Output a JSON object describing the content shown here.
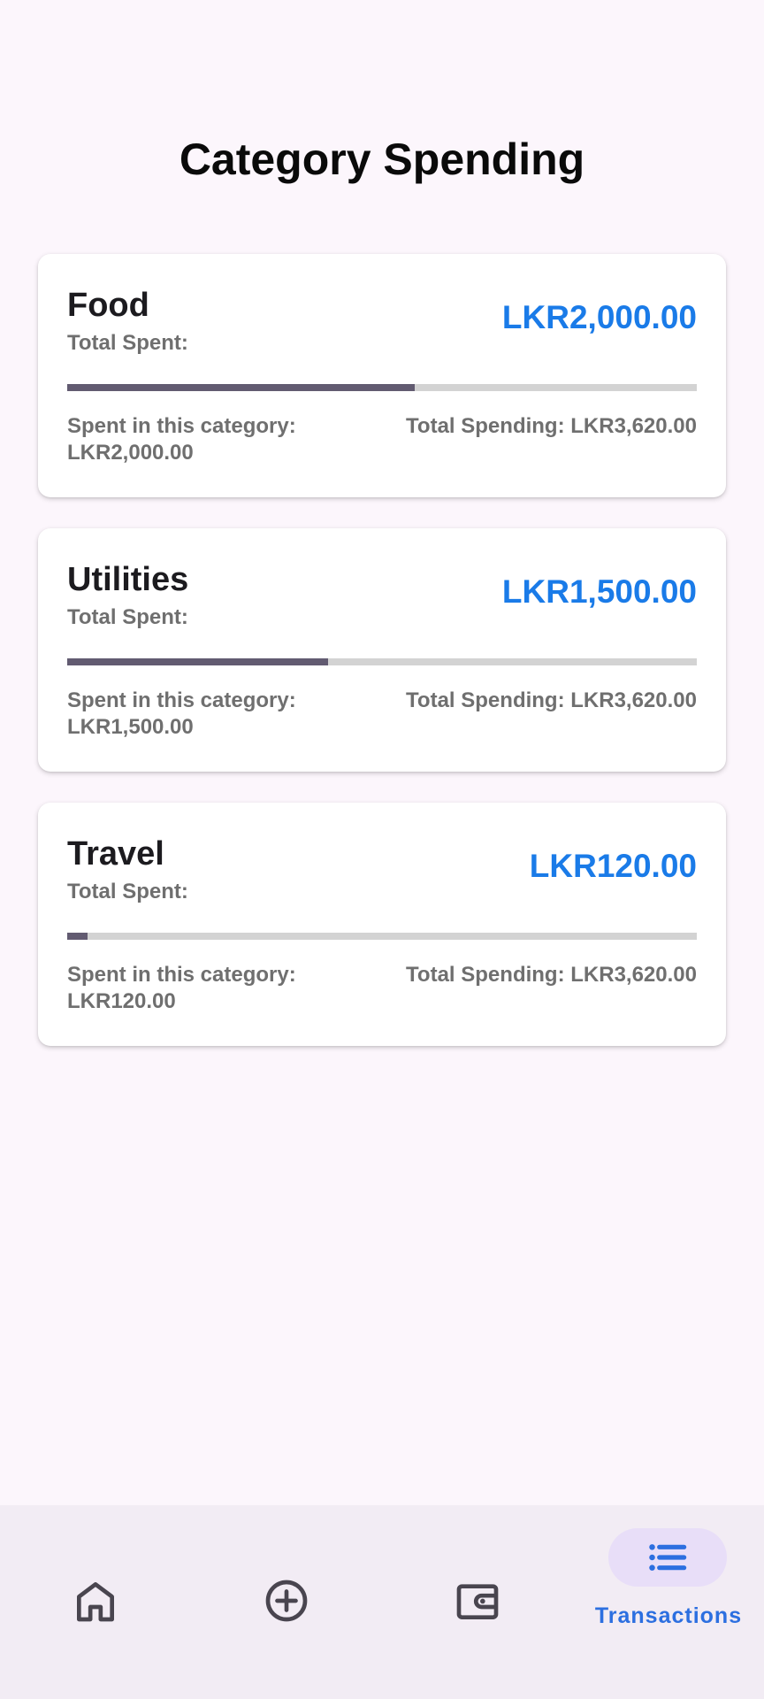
{
  "page": {
    "title": "Category Spending"
  },
  "cards": [
    {
      "name": "Food",
      "total_label": "Total Spent:",
      "amount": "LKR2,000.00",
      "progress": 0.552,
      "spent_label": "Spent in this category:",
      "spent_value": "LKR2,000.00",
      "total_spending": "Total Spending: LKR3,620.00"
    },
    {
      "name": "Utilities",
      "total_label": "Total Spent:",
      "amount": "LKR1,500.00",
      "progress": 0.414,
      "spent_label": "Spent in this category:",
      "spent_value": "LKR1,500.00",
      "total_spending": "Total Spending: LKR3,620.00"
    },
    {
      "name": "Travel",
      "total_label": "Total Spent:",
      "amount": "LKR120.00",
      "progress": 0.033,
      "spent_label": "Spent in this category:",
      "spent_value": "LKR120.00",
      "total_spending": "Total Spending: LKR3,620.00"
    }
  ],
  "bottom_nav": {
    "items": [
      {
        "icon": "home-icon",
        "label": ""
      },
      {
        "icon": "add-circle-icon",
        "label": ""
      },
      {
        "icon": "wallet-icon",
        "label": ""
      },
      {
        "icon": "list-icon",
        "label": "Transactions",
        "active": true
      }
    ]
  },
  "colors": {
    "background": "#fcf6fc",
    "accent_amount": "#1a7be8",
    "progress_fill": "#625b71",
    "progress_track": "#d3d3d3",
    "nav_active_pill": "#e8def8",
    "nav_active_label": "#2c6fe0"
  }
}
